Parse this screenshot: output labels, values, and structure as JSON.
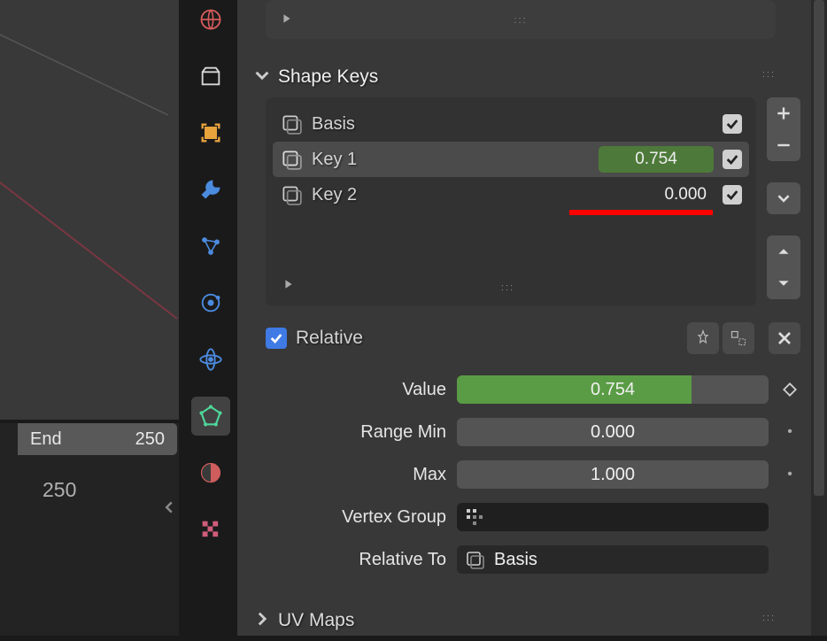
{
  "timeline": {
    "end_label": "End",
    "end_value": "250",
    "frame_display": "250"
  },
  "tabs": [
    {
      "name": "world",
      "color": "#d45b5b"
    },
    {
      "name": "collection",
      "color": "#d8d8d8"
    },
    {
      "name": "object",
      "color": "#e8a33d"
    },
    {
      "name": "modifiers",
      "color": "#4b8bdf"
    },
    {
      "name": "particles",
      "color": "#4b8bdf"
    },
    {
      "name": "physics",
      "color": "#4b8bdf"
    },
    {
      "name": "constraints",
      "color": "#4b8bdf"
    },
    {
      "name": "mesh-data",
      "color": "#4fd69a",
      "active": true
    },
    {
      "name": "material",
      "color": "#cf5d5d"
    },
    {
      "name": "texture",
      "color": "#cf5d7a"
    }
  ],
  "panel_shapekeys": {
    "title": "Shape Keys",
    "items": [
      {
        "name": "Basis",
        "value": null,
        "checked": true,
        "selected": false
      },
      {
        "name": "Key 1",
        "value": "0.754",
        "checked": true,
        "selected": true,
        "green": true
      },
      {
        "name": "Key 2",
        "value": "0.000",
        "checked": true,
        "selected": false,
        "underline": true
      }
    ]
  },
  "relative": {
    "label": "Relative",
    "checked": true
  },
  "props": {
    "value_label": "Value",
    "value": "0.754",
    "value_pct": 75.4,
    "range_min_label": "Range Min",
    "range_min": "0.000",
    "max_label": "Max",
    "max": "1.000",
    "vertex_group_label": "Vertex Group",
    "vertex_group": "",
    "relative_to_label": "Relative To",
    "relative_to": "Basis"
  },
  "panel_uvmaps": {
    "title": "UV Maps"
  },
  "icons": {
    "plus": "+",
    "minus": "−",
    "chevron_down": "▾",
    "up": "▴",
    "down": "▾",
    "pin": "pin",
    "shapekey_edit": "edit",
    "close": "×",
    "diamond": "◇",
    "dot": "•"
  }
}
